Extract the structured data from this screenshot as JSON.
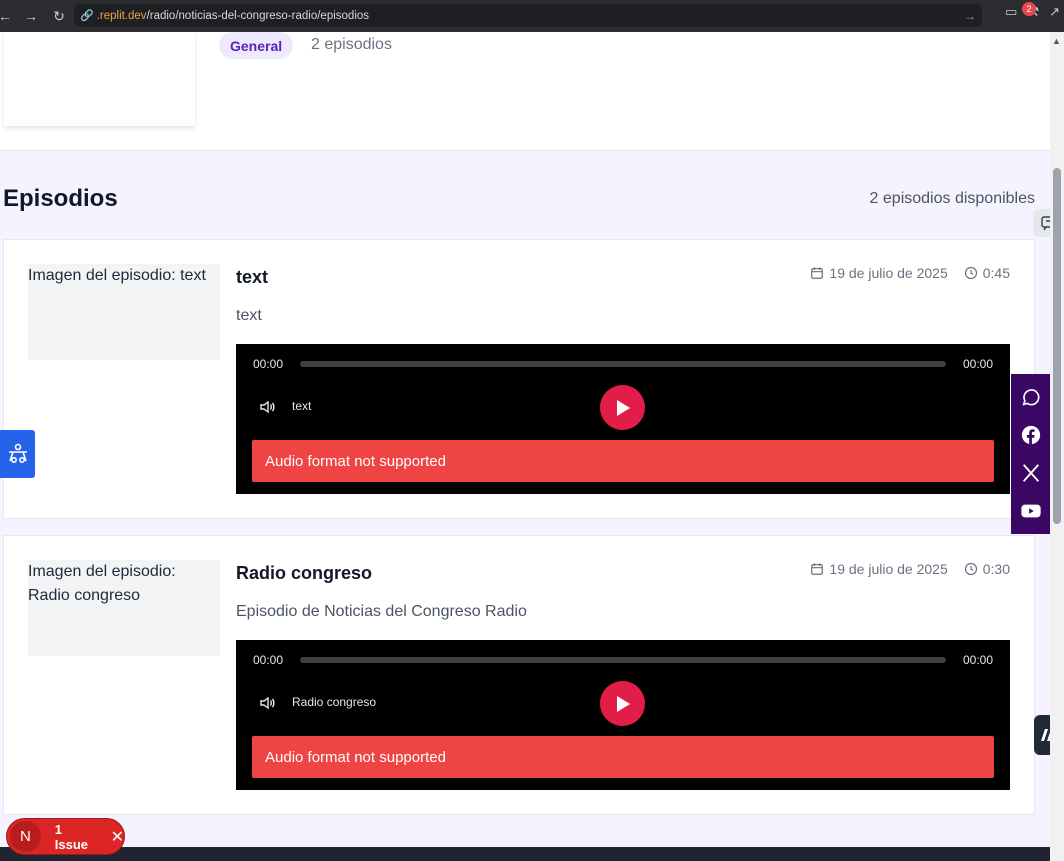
{
  "browser": {
    "url_host": ".replit.dev",
    "url_path": "/radio/noticias-del-congreso-radio/episodios",
    "notification_count": "2"
  },
  "header": {
    "category": "General",
    "episode_count": "2 episodios"
  },
  "section": {
    "title": "Episodios",
    "available": "2 episodios disponibles"
  },
  "episodes": [
    {
      "image_alt": "Imagen del episodio: text",
      "title": "text",
      "date": "19 de julio de 2025",
      "duration": "0:45",
      "description": "text",
      "player": {
        "current": "00:00",
        "total": "00:00",
        "track_name": "text",
        "error": "Audio format not supported",
        "progress": 0
      }
    },
    {
      "image_alt": "Imagen del episodio: Radio congreso",
      "title": "Radio congreso",
      "date": "19 de julio de 2025",
      "duration": "0:30",
      "description": "Episodio de Noticias del Congreso Radio",
      "player": {
        "current": "00:00",
        "total": "00:00",
        "track_name": "Radio congreso",
        "error": "Audio format not supported",
        "progress": 0
      }
    }
  ],
  "social": [
    "whatsapp-icon",
    "facebook-icon",
    "x-icon",
    "youtube-icon"
  ],
  "issue": {
    "letter": "N",
    "label": "1 Issue"
  },
  "colors": {
    "accent": "#e11d48",
    "error": "#ef4444",
    "social_bg": "#3b0764",
    "a11y": "#2563eb"
  }
}
